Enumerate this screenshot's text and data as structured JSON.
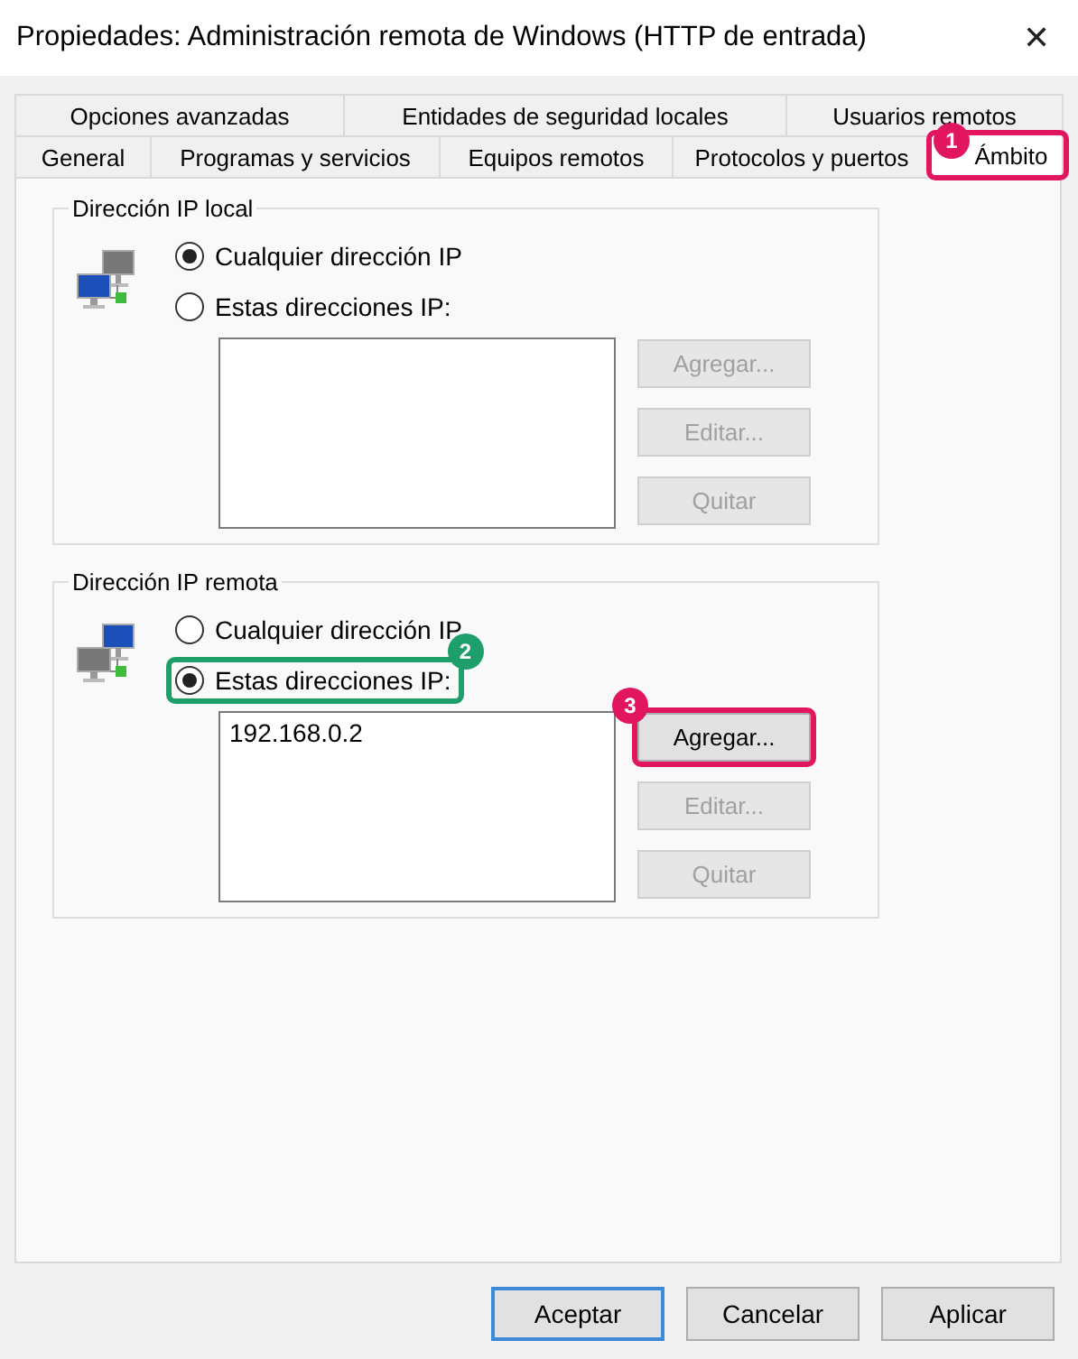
{
  "window": {
    "title": "Propiedades: Administración remota de Windows (HTTP de entrada)",
    "close": "✕"
  },
  "tab_rows": [
    {
      "tabs": [
        {
          "label": "Opciones avanzadas",
          "selected": false
        },
        {
          "label": "Entidades de seguridad locales",
          "selected": false
        },
        {
          "label": "Usuarios remotos",
          "selected": false
        }
      ]
    },
    {
      "tabs": [
        {
          "label": "General",
          "selected": false
        },
        {
          "label": "Programas y servicios",
          "selected": false
        },
        {
          "label": "Equipos remotos",
          "selected": false
        },
        {
          "label": "Protocolos y puertos",
          "selected": false
        },
        {
          "label": "Ámbito",
          "selected": true,
          "callout": {
            "number": "1",
            "color": "#e2165e"
          }
        }
      ]
    }
  ],
  "groups": [
    {
      "title": "Dirección IP local",
      "radios": [
        {
          "label": "Cualquier dirección IP",
          "selected": true
        },
        {
          "label": "Estas direcciones IP:",
          "selected": false
        }
      ],
      "buttons": [
        {
          "label": "Agregar...",
          "disabled": true
        },
        {
          "label": "Editar...",
          "disabled": true
        },
        {
          "label": "Quitar",
          "disabled": true
        }
      ]
    },
    {
      "title": "Dirección IP remota",
      "radios": [
        {
          "label": "Cualquier dirección IP",
          "selected": false
        },
        {
          "label": "Estas direcciones IP:",
          "selected": true,
          "callout": {
            "number": "2",
            "color": "#1e9e6a"
          }
        }
      ],
      "addresses": [
        "192.168.0.2"
      ],
      "buttons": [
        {
          "label": "Agregar...",
          "disabled": false,
          "callout": {
            "number": "3",
            "color": "#e2165e"
          }
        },
        {
          "label": "Editar...",
          "disabled": true
        },
        {
          "label": "Quitar",
          "disabled": true
        }
      ]
    }
  ],
  "footer_buttons": [
    {
      "label": "Aceptar",
      "default": true
    },
    {
      "label": "Cancelar",
      "default": false
    },
    {
      "label": "Aplicar",
      "default": false
    }
  ]
}
